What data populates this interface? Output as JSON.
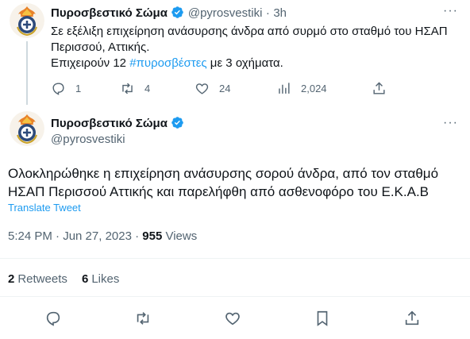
{
  "colors": {
    "accent": "#1d9bf0",
    "text": "#0f1419",
    "muted": "#536471",
    "divider": "#eff3f4"
  },
  "tweet1": {
    "author_name": "Πυροσβεστικό Σώμα",
    "handle": "@pyrosvestiki",
    "separator": "·",
    "time": "3h",
    "line1": "Σε εξέλιξη επιχείρηση ανάσυρσης άνδρα από συρμό στο σταθμό του ΗΣΑΠ",
    "line2": "Περισσού, Αττικής.",
    "line3_pre": "Επιχειρούν 12 ",
    "hashtag": "#πυροσβέστες",
    "line3_post": " με 3 οχήματα.",
    "actions": {
      "replies": "1",
      "retweets": "4",
      "likes": "24",
      "views": "2,024"
    }
  },
  "tweet2": {
    "author_name": "Πυροσβεστικό Σώμα",
    "handle": "@pyrosvestiki",
    "line1": "Ολοκληρώθηκε η επιχείρηση ανάσυρσης σορού άνδρα, από τον σταθμό",
    "line2": "ΗΣΑΠ Περισσού Αττικής και παρελήφθη από ασθενοφόρο του Ε.Κ.Α.Β",
    "translate": "Translate Tweet",
    "timestamp": "5:24 PM · Jun 27, 2023 · ",
    "views_count": "955",
    "views_label": " Views",
    "retweets_count": "2",
    "retweets_label": "Retweets",
    "likes_count": "6",
    "likes_label": "Likes"
  },
  "icons": [
    "avatar-emblem",
    "verified-icon",
    "more-icon",
    "reply-icon",
    "retweet-icon",
    "like-icon",
    "views-icon",
    "share-icon",
    "bookmark-icon"
  ]
}
